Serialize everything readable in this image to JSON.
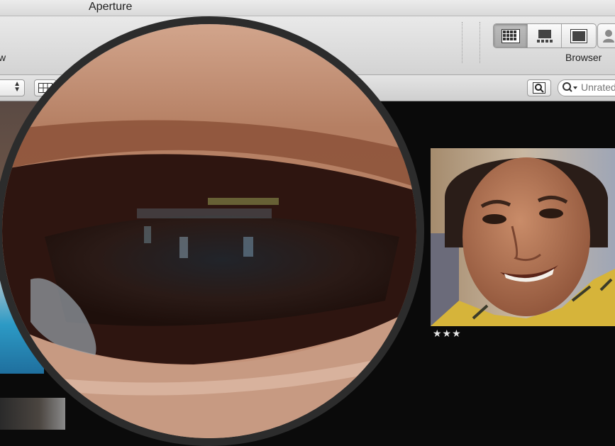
{
  "window": {
    "title": "Aperture"
  },
  "toolbar": {
    "left_label_fragment": "w",
    "view_buttons": [
      {
        "name": "grid-view",
        "icon": "grid-icon",
        "active": true
      },
      {
        "name": "split-view",
        "icon": "filmstrip-icon",
        "active": false
      },
      {
        "name": "viewer",
        "icon": "viewer-icon",
        "active": false
      }
    ],
    "faces_icon": "person-icon",
    "browser_label": "Browser"
  },
  "filterbar": {
    "search_placeholder": "Unrated or Better"
  },
  "photos": [
    {
      "name": "portrait-smiling-woman",
      "rating": "★★★"
    }
  ],
  "colors": {
    "background": "#0a0a0a",
    "toolbar": "#dedede",
    "rating_star": "#e5e5e5"
  }
}
